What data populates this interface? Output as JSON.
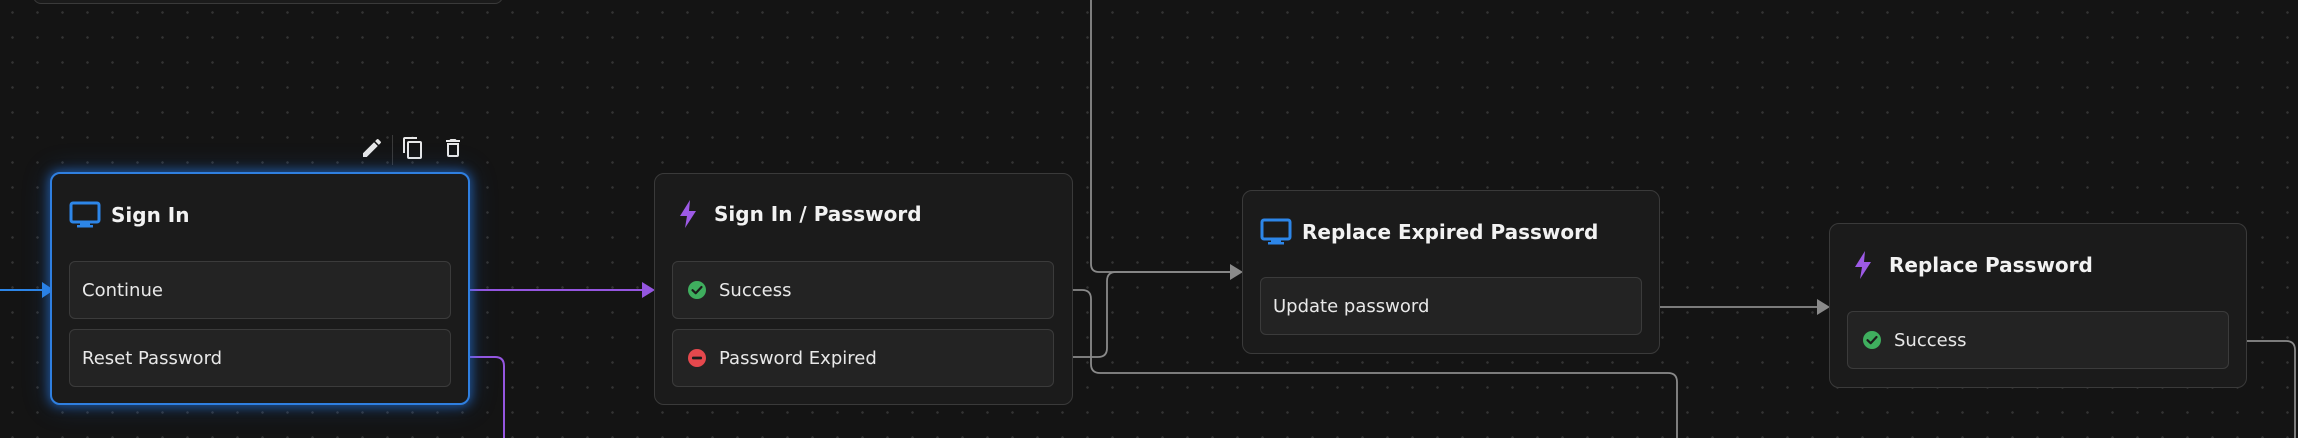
{
  "colors": {
    "background": "#141414",
    "grid_dot": "#333333",
    "node_bg": "#1b1b1b",
    "row_bg": "#232323",
    "selected_border": "#2f7fe0",
    "screen_icon": "#2d86e8",
    "action_icon": "#9d5ae6",
    "edge_purple": "#9556e0",
    "edge_blue": "#2d86e8",
    "edge_gray": "#8a8a8a",
    "success": "#3fae5e",
    "error": "#e5484d"
  },
  "toolbar": {
    "edit_icon": "pencil-icon",
    "duplicate_icon": "copy-icon",
    "delete_icon": "trash-icon"
  },
  "nodes": {
    "sign_in": {
      "title": "Sign In",
      "icon": "monitor-icon",
      "rows": [
        "Continue",
        "Reset Password"
      ]
    },
    "sign_in_password": {
      "title": "Sign In / Password",
      "icon": "bolt-icon",
      "rows": [
        {
          "label": "Success",
          "status": "success"
        },
        {
          "label": "Password Expired",
          "status": "error"
        }
      ]
    },
    "replace_expired_password": {
      "title": "Replace Expired Password",
      "icon": "monitor-icon",
      "rows": [
        "Update password"
      ]
    },
    "replace_password": {
      "title": "Replace Password",
      "icon": "bolt-icon",
      "rows": [
        {
          "label": "Success",
          "status": "success"
        }
      ]
    }
  }
}
